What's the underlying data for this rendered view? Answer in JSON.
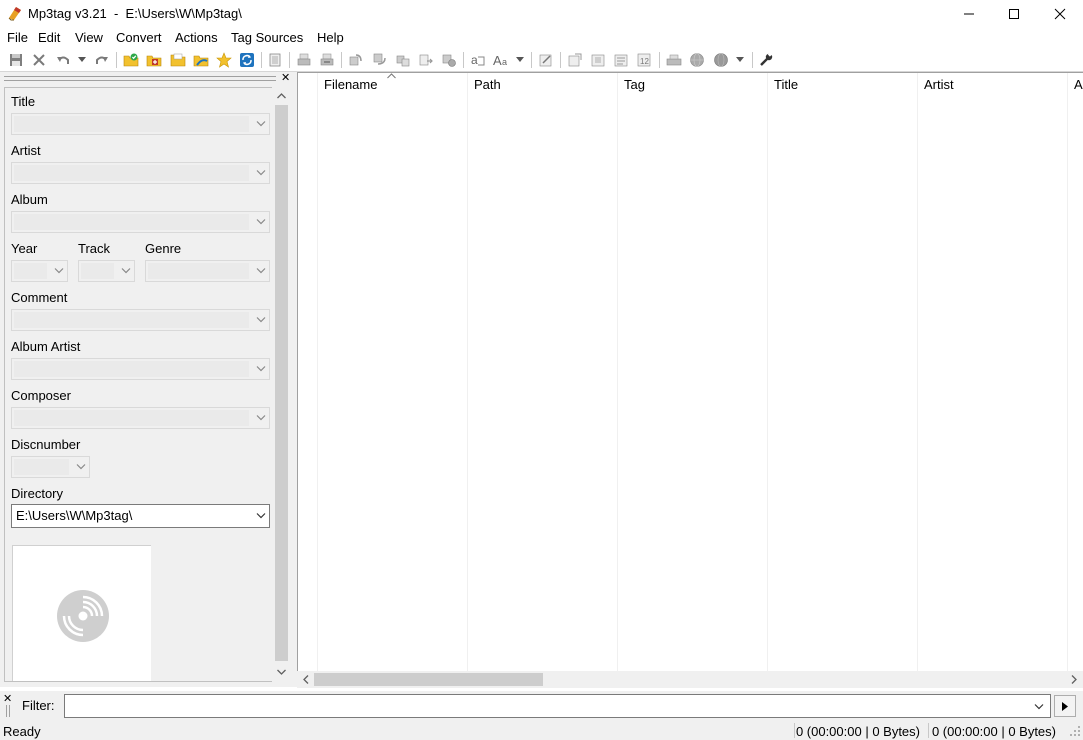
{
  "window": {
    "title": "Mp3tag v3.21  -  E:\\Users\\W\\Mp3tag\\"
  },
  "menu": [
    "File",
    "Edit",
    "View",
    "Convert",
    "Actions",
    "Tag Sources",
    "Help"
  ],
  "toolbar_icons": [
    "save-icon",
    "remove-tag-icon",
    "undo-icon",
    "undo-dropdown-icon",
    "redo-icon",
    "change-directory-icon",
    "add-directory-icon",
    "open-folder-icon",
    "favorite-folder-icon",
    "favorites-star-icon",
    "refresh-icon",
    "extended-tags-icon",
    "export-icon",
    "playlist-icon",
    "tag-to-filename-icon",
    "filename-to-tag-icon",
    "tag-to-tag-icon",
    "text-file-to-tag-icon",
    "actions-icon",
    "replace-icon",
    "case-conversion-icon",
    "case-dropdown-icon",
    "edit-tag-icon",
    "auto-number-icon",
    "options-icon"
  ],
  "tag_panel": {
    "labels": {
      "title": "Title",
      "artist": "Artist",
      "album": "Album",
      "year": "Year",
      "track": "Track",
      "genre": "Genre",
      "comment": "Comment",
      "album_artist": "Album Artist",
      "composer": "Composer",
      "discnumber": "Discnumber",
      "directory": "Directory"
    },
    "directory_value": "E:\\Users\\W\\Mp3tag\\"
  },
  "file_list": {
    "columns": [
      "Filename",
      "Path",
      "Tag",
      "Title",
      "Artist",
      "A"
    ],
    "rows": []
  },
  "filter": {
    "label": "Filter:",
    "value": ""
  },
  "status": {
    "ready": "Ready",
    "selected": "0 (00:00:00 | 0 Bytes)",
    "total": "0 (00:00:00 | 0 Bytes)"
  },
  "colors": {
    "panel_bg": "#f0f0f0",
    "scroll_thumb": "#cdcdcd",
    "accent_blue": "#1e73be",
    "folder_yellow": "#f2c12e",
    "add_green": "#2ea84a"
  }
}
